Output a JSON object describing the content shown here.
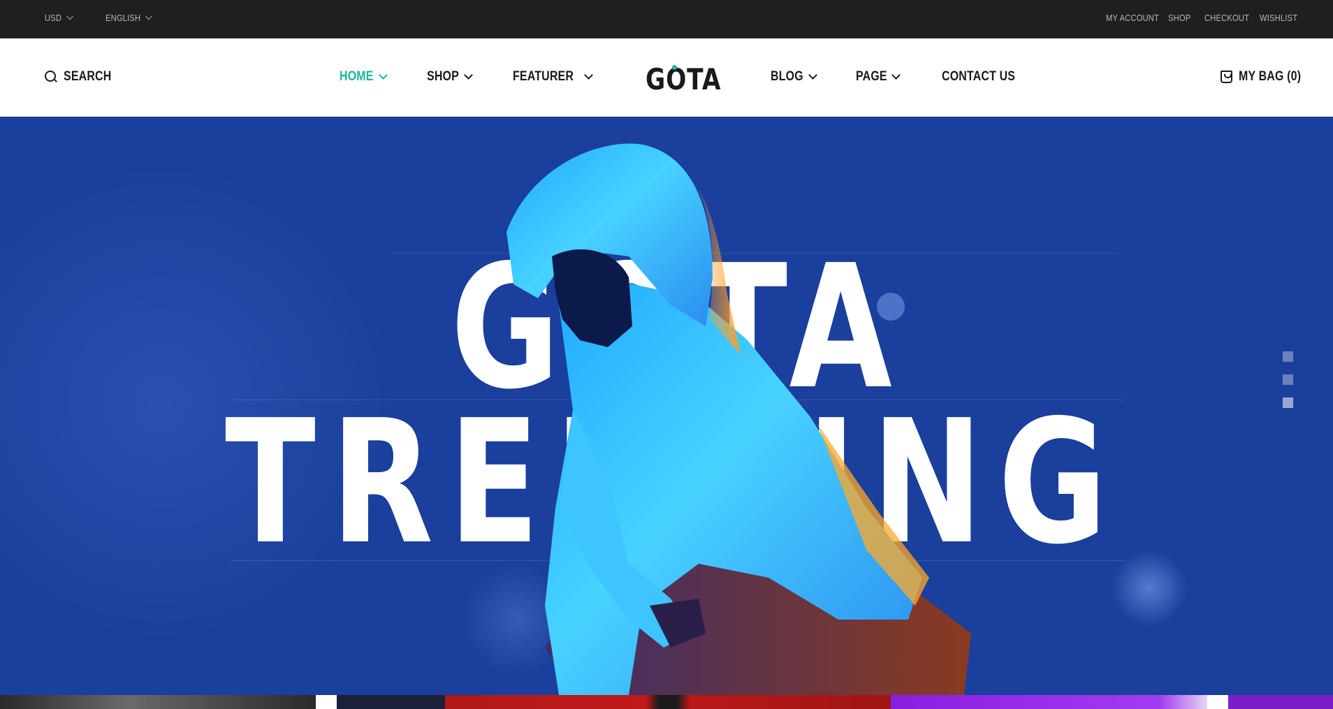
{
  "topbar": {
    "currency": "USD",
    "language": "ENGLISH",
    "links": [
      "MY ACCOUNT",
      "SHOP",
      "CHECKOUT",
      "WISHLIST"
    ]
  },
  "header": {
    "search_label": "SEARCH",
    "logo": "GOTA",
    "nav": [
      "HOME",
      "SHOP",
      "FEATURER",
      "BLOG",
      "PAGE",
      "CONTACT US"
    ],
    "bag_label": "MY BAG (0)"
  },
  "hero": {
    "line1": "GOTA",
    "line2": "TRENDING",
    "slides_count": 3,
    "active_slide": 3
  },
  "colors": {
    "accent": "#1bb5a0",
    "hero_bg": "#1a3f9c",
    "topbar_bg": "#1f1f1f"
  }
}
